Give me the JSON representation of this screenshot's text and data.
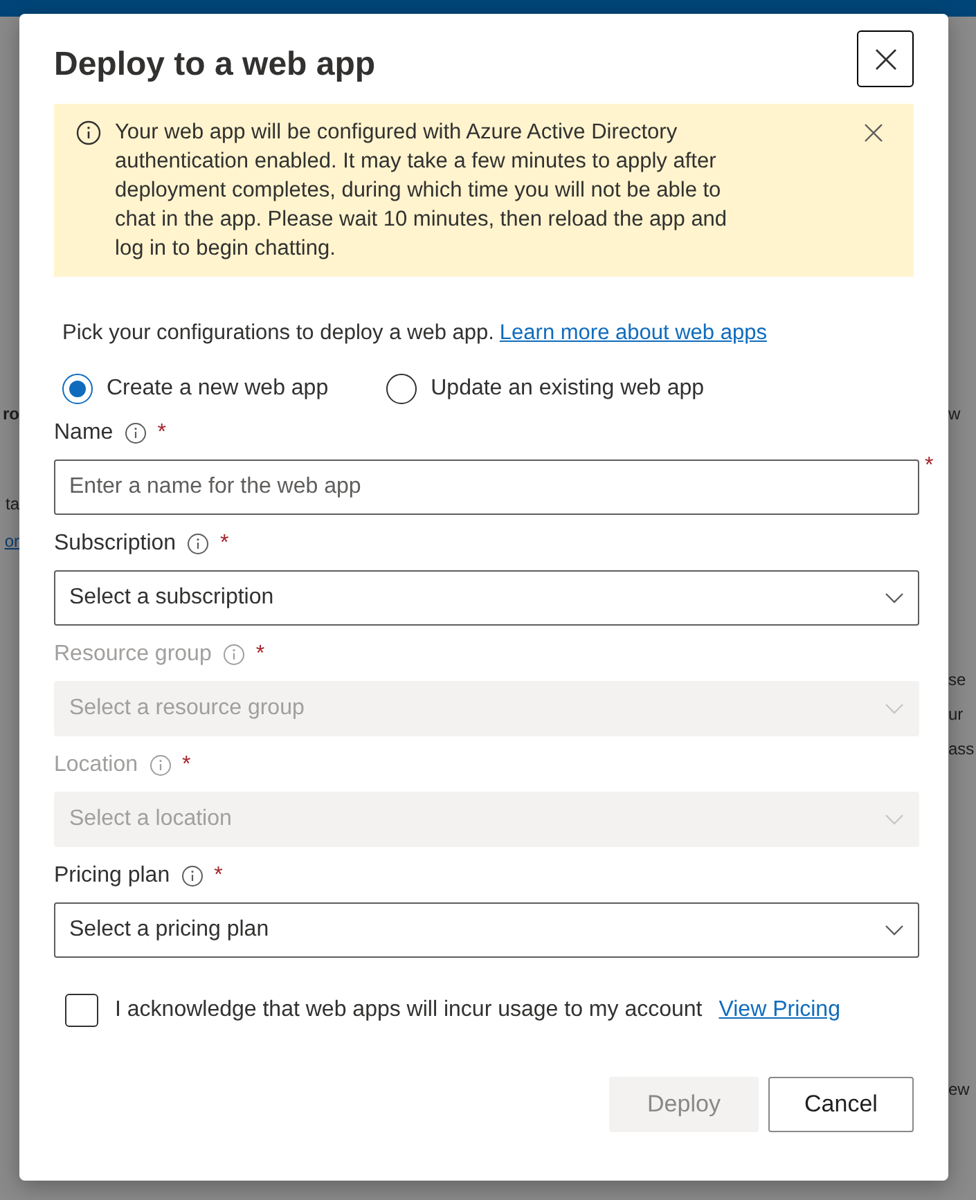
{
  "background": {
    "left_fragments": [
      {
        "text": "ro",
        "kind": "heading"
      },
      {
        "text": "ta",
        "kind": "text"
      },
      {
        "text": "or",
        "kind": "link"
      }
    ],
    "right_fragments": [
      {
        "text": "w"
      },
      {
        "text": "se"
      },
      {
        "text": "ur"
      },
      {
        "text": "ass"
      },
      {
        "text": "ew"
      }
    ]
  },
  "dialog": {
    "title": "Deploy to a web app",
    "banner": {
      "text": "Your web app will be configured with Azure Active Directory authentication enabled. It may take a few minutes to apply after deployment completes, during which time you will not be able to chat in the app. Please wait 10 minutes, then reload the app and log in to begin chatting."
    },
    "intro": "Pick your configurations to deploy a web app.",
    "intro_link": "Learn more about web apps",
    "modes": [
      {
        "label": "Create a new web app",
        "selected": true
      },
      {
        "label": "Update an existing web app",
        "selected": false
      }
    ],
    "fields": [
      {
        "label": "Name",
        "kind": "text",
        "placeholder": "Enter a name for the web app",
        "disabled": false
      },
      {
        "label": "Subscription",
        "kind": "dropdown",
        "placeholder": "Select a subscription",
        "disabled": false
      },
      {
        "label": "Resource group",
        "kind": "dropdown",
        "placeholder": "Select a resource group",
        "disabled": true
      },
      {
        "label": "Location",
        "kind": "dropdown",
        "placeholder": "Select a location",
        "disabled": true
      },
      {
        "label": "Pricing plan",
        "kind": "dropdown",
        "placeholder": "Select a pricing plan",
        "disabled": false
      }
    ],
    "required_mark": "*",
    "acknowledge": {
      "label": "I acknowledge that web apps will incur usage to my account",
      "checked": false,
      "link": "View Pricing"
    },
    "buttons": [
      {
        "label": "Deploy",
        "kind": "primary",
        "disabled": true
      },
      {
        "label": "Cancel",
        "kind": "secondary",
        "disabled": false
      }
    ]
  }
}
